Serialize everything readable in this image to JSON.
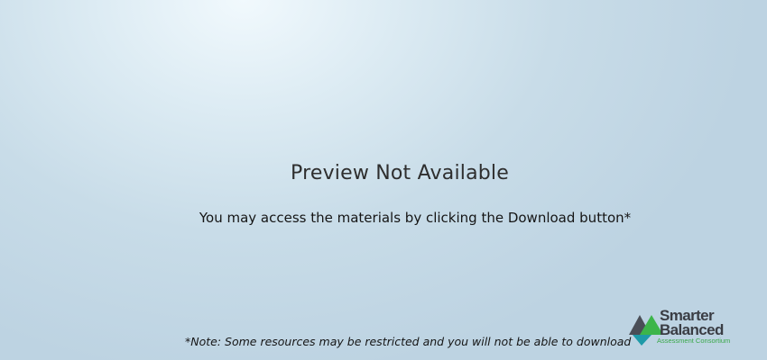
{
  "preview": {
    "title": "Preview Not Available",
    "message": "You may access the materials by clicking the Download button*",
    "note": "*Note:  Some resources may be restricted and you will not be able to download"
  },
  "logo": {
    "line1": "Smarter",
    "line2": "Balanced",
    "tagline": "Assessment Consortium",
    "colors": {
      "dark": "#4a4e57",
      "green": "#3cb54a",
      "teal": "#1e9aa8"
    }
  }
}
